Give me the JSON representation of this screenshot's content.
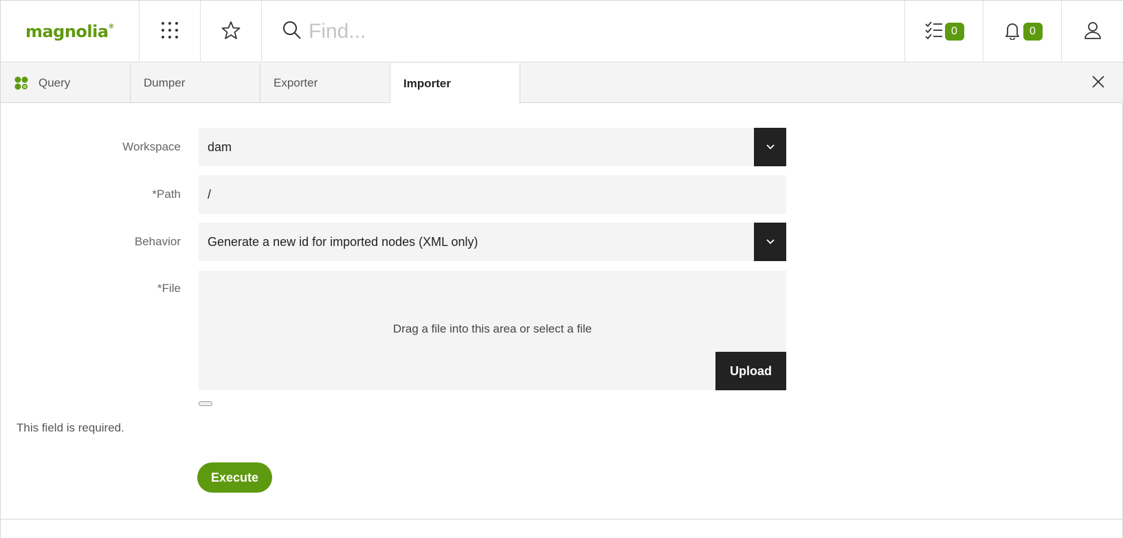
{
  "header": {
    "logo_text": "magnolia",
    "logo_mark": "®",
    "apps_icon": "grid-dots-icon",
    "favorites_icon": "star-icon",
    "search_placeholder": "Find...",
    "tasks_count": "0",
    "notifications_count": "0",
    "accent_color": "#5e9a0f"
  },
  "tabs": [
    {
      "label": "Query",
      "icon": "query-app-icon"
    },
    {
      "label": "Dumper"
    },
    {
      "label": "Exporter"
    },
    {
      "label": "Importer",
      "active": true
    }
  ],
  "form": {
    "workspace_label": "Workspace",
    "workspace_value": "dam",
    "path_label": "*Path",
    "path_value": "/",
    "behavior_label": "Behavior",
    "behavior_value": "Generate a new id for imported nodes (XML only)",
    "file_label": "*File",
    "drop_text": "Drag a file into this area or select a file",
    "upload_label": "Upload",
    "error_text": "This field is required.",
    "execute_label": "Execute"
  }
}
